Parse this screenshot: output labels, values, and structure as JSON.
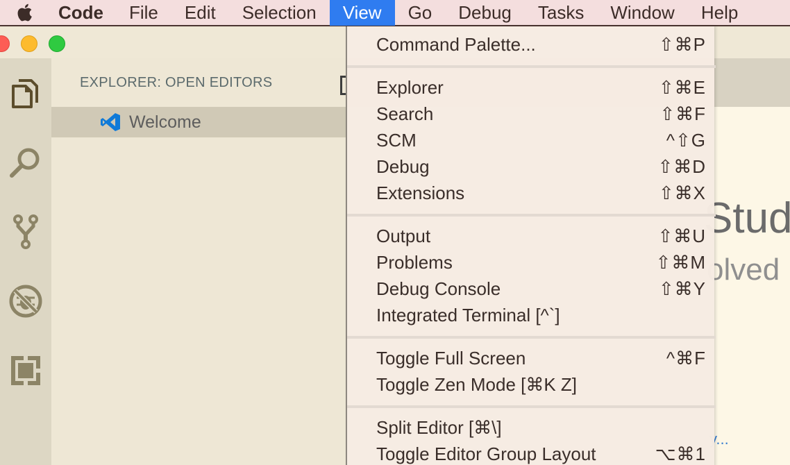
{
  "menubar": {
    "apple_icon": "apple-logo-icon",
    "items": [
      {
        "label": "Code"
      },
      {
        "label": "File"
      },
      {
        "label": "Edit"
      },
      {
        "label": "Selection"
      },
      {
        "label": "View",
        "active": true
      },
      {
        "label": "Go"
      },
      {
        "label": "Debug"
      },
      {
        "label": "Tasks"
      },
      {
        "label": "Window"
      },
      {
        "label": "Help"
      }
    ]
  },
  "colors": {
    "menu_highlight": "#2f7cf0",
    "activity_icon_active": "#5c4d2c",
    "activity_icon": "#8c8466",
    "vscode_blue": "#0f7ad8",
    "link": "#3a7fd0"
  },
  "activitybar": {
    "icons": [
      "files-icon",
      "search-icon",
      "source-control-icon",
      "debug-icon",
      "extensions-icon"
    ]
  },
  "sidebar": {
    "title": "EXPLORER: OPEN EDITORS",
    "open_editors": [
      {
        "label": "Welcome",
        "icon": "vscode-logo-icon"
      }
    ]
  },
  "editor": {
    "heading_fragment": "Stud",
    "subheading_fragment": "olved",
    "link_fragment": "y..."
  },
  "view_menu": {
    "groups": [
      [
        {
          "label": "Command Palette...",
          "shortcut": "⇧⌘P"
        }
      ],
      [
        {
          "label": "Explorer",
          "shortcut": "⇧⌘E"
        },
        {
          "label": "Search",
          "shortcut": "⇧⌘F"
        },
        {
          "label": "SCM",
          "shortcut": "^⇧G"
        },
        {
          "label": "Debug",
          "shortcut": "⇧⌘D"
        },
        {
          "label": "Extensions",
          "shortcut": "⇧⌘X"
        }
      ],
      [
        {
          "label": "Output",
          "shortcut": "⇧⌘U"
        },
        {
          "label": "Problems",
          "shortcut": "⇧⌘M"
        },
        {
          "label": "Debug Console",
          "shortcut": "⇧⌘Y"
        },
        {
          "label": "Integrated Terminal [^`]",
          "shortcut": ""
        }
      ],
      [
        {
          "label": "Toggle Full Screen",
          "shortcut": "^⌘F"
        },
        {
          "label": "Toggle Zen Mode [⌘K Z]",
          "shortcut": ""
        }
      ],
      [
        {
          "label": "Split Editor [⌘\\]",
          "shortcut": ""
        },
        {
          "label": "Toggle Editor Group Layout",
          "shortcut": "⌥⌘1"
        }
      ]
    ]
  }
}
